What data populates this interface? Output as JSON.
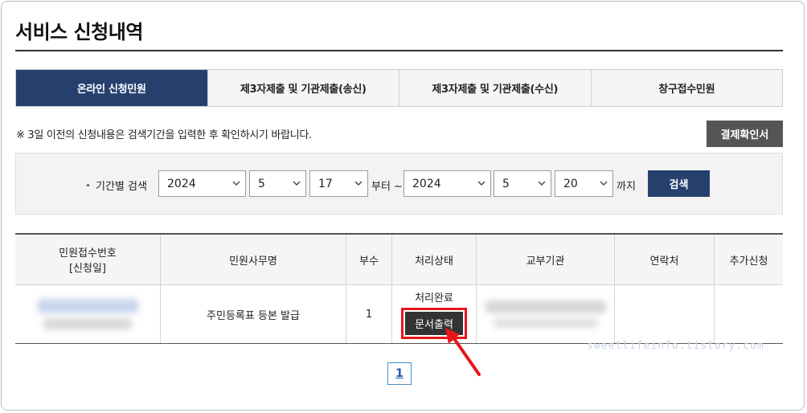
{
  "page": {
    "title": "서비스 신청내역"
  },
  "tabs": [
    {
      "label": "온라인 신청민원",
      "active": true
    },
    {
      "label": "제3자제출 및 기관제출(송신)",
      "active": false
    },
    {
      "label": "제3자제출 및 기관제출(수신)",
      "active": false
    },
    {
      "label": "창구접수민원",
      "active": false
    }
  ],
  "notice": "※ 3일 이전의 신청내용은 검색기간을 입력한 후 확인하시기 바랍니다.",
  "receipt_button": "결제확인서",
  "search": {
    "label": "기간별 검색",
    "from_year": "2024",
    "from_month": "5",
    "from_day": "17",
    "from_word": "부터 ~",
    "to_year": "2024",
    "to_month": "5",
    "to_day": "20",
    "to_word": "까지",
    "button": "검색"
  },
  "table": {
    "headers": {
      "receipt_no": "민원접수번호",
      "receipt_date": "[신청일]",
      "service": "민원사무명",
      "copies": "부수",
      "status": "처리상태",
      "agency": "교부기관",
      "contact": "연락처",
      "extra": "추가신청"
    },
    "rows": [
      {
        "service": "주민등록표 등본 발급",
        "copies": "1",
        "status": "처리완료",
        "print_button": "문서출력"
      }
    ]
  },
  "pagination": {
    "current": "1"
  },
  "watermark": "sweetlifeinfo.tistory.com",
  "colors": {
    "accent": "#26406e",
    "highlight": "#e8141b"
  }
}
